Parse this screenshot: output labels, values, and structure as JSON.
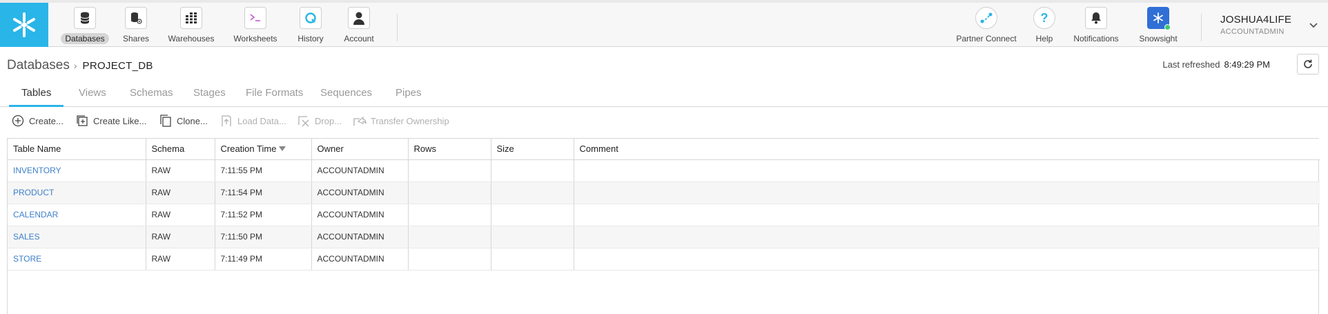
{
  "nav": {
    "items": [
      {
        "label": "Databases",
        "icon": "database-icon"
      },
      {
        "label": "Shares",
        "icon": "share-icon"
      },
      {
        "label": "Warehouses",
        "icon": "warehouse-icon"
      },
      {
        "label": "Worksheets",
        "icon": "terminal-icon"
      },
      {
        "label": "History",
        "icon": "history-icon"
      },
      {
        "label": "Account",
        "icon": "account-icon"
      }
    ],
    "right_items": [
      {
        "label": "Partner Connect",
        "icon": "partner-connect-icon"
      },
      {
        "label": "Help",
        "icon": "help-icon"
      },
      {
        "label": "Notifications",
        "icon": "bell-icon"
      },
      {
        "label": "Snowsight",
        "icon": "snowsight-icon"
      }
    ],
    "user": {
      "name": "JOSHUA4LIFE",
      "role": "ACCOUNTADMIN"
    }
  },
  "breadcrumb": {
    "root": "Databases",
    "separator": "›",
    "current": "PROJECT_DB"
  },
  "refresh": {
    "label": "Last refreshed",
    "time": "8:49:29 PM"
  },
  "tabs": [
    "Tables",
    "Views",
    "Schemas",
    "Stages",
    "File Formats",
    "Sequences",
    "Pipes"
  ],
  "toolbar": {
    "create": "Create...",
    "create_like": "Create Like...",
    "clone": "Clone...",
    "load_data": "Load Data...",
    "drop": "Drop...",
    "transfer_ownership": "Transfer Ownership"
  },
  "table": {
    "columns": [
      "Table Name",
      "Schema",
      "Creation Time",
      "Owner",
      "Rows",
      "Size",
      "Comment"
    ],
    "rows": [
      [
        "INVENTORY",
        "RAW",
        "7:11:55 PM",
        "ACCOUNTADMIN",
        "",
        "",
        ""
      ],
      [
        "PRODUCT",
        "RAW",
        "7:11:54 PM",
        "ACCOUNTADMIN",
        "",
        "",
        ""
      ],
      [
        "CALENDAR",
        "RAW",
        "7:11:52 PM",
        "ACCOUNTADMIN",
        "",
        "",
        ""
      ],
      [
        "SALES",
        "RAW",
        "7:11:50 PM",
        "ACCOUNTADMIN",
        "",
        "",
        ""
      ],
      [
        "STORE",
        "RAW",
        "7:11:49 PM",
        "ACCOUNTADMIN",
        "",
        "",
        ""
      ]
    ]
  },
  "colors": {
    "brand": "#29b5e8",
    "link": "#3d7fc9",
    "snowsight": "#2f6fd6",
    "status_dot": "#3ec96b"
  }
}
